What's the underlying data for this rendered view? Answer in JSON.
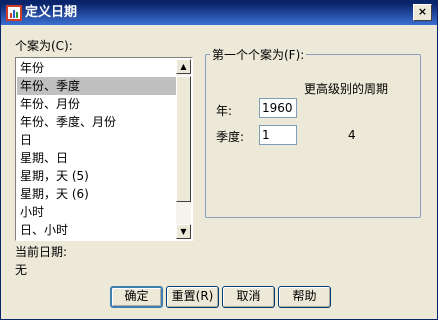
{
  "window": {
    "title": "定义日期",
    "close_glyph": "×"
  },
  "cases": {
    "label": "个案为(C):",
    "items": [
      "年份",
      "年份、季度",
      "年份、月份",
      "年份、季度、月份",
      "日",
      "星期、日",
      "星期，天 (5)",
      "星期，天 (6)",
      "小时",
      "日、小时"
    ],
    "selected_index": 1
  },
  "first_case": {
    "legend": "第一个个案为(F):",
    "higher_level_header": "更高级别的周期",
    "year_label": "年:",
    "year_value": "1960",
    "quarter_label": "季度:",
    "quarter_value": "1",
    "quarter_periodicity": "4"
  },
  "current_dates": {
    "label": "当前日期:",
    "value": "无"
  },
  "buttons": {
    "ok": "确定",
    "reset": "重置(R)",
    "cancel": "取消",
    "help": "帮助"
  },
  "colors": {
    "title_bar": "#0a246a",
    "selection": "#c0c0c0",
    "dialog_bg": "#ece9d8"
  }
}
